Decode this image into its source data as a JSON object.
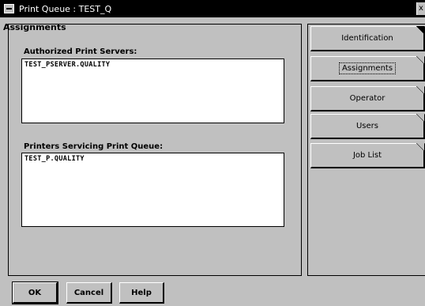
{
  "window": {
    "title": "Print Queue : TEST_Q",
    "close_glyph": "x"
  },
  "panel": {
    "title": "Assignments",
    "print_servers": {
      "label": "Authorized Print Servers:",
      "items": [
        "TEST_PSERVER.QUALITY"
      ]
    },
    "printers": {
      "label": "Printers Servicing Print Queue:",
      "items": [
        "TEST_P.QUALITY"
      ]
    }
  },
  "tabs": [
    {
      "label": "Identification",
      "active": true
    },
    {
      "label": "Assignments",
      "selected": true
    },
    {
      "label": "Operator"
    },
    {
      "label": "Users"
    },
    {
      "label": "Job List"
    }
  ],
  "buttons": {
    "ok": "OK",
    "cancel": "Cancel",
    "help": "Help"
  }
}
